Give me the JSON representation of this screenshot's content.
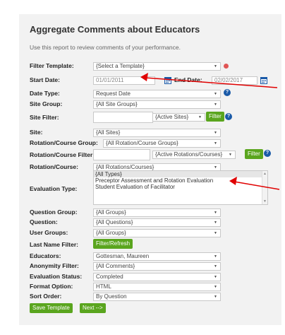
{
  "header": {
    "title": "Aggregate Comments about Educators",
    "subtitle": "Use this report to review comments of your performance."
  },
  "form": {
    "filter_template": {
      "label": "Filter Template:",
      "value": "{Select a Template}"
    },
    "start_date": {
      "label": "Start Date:",
      "value": "01/01/2011"
    },
    "end_date": {
      "label": "End Date:",
      "value": "02/02/2017"
    },
    "date_type": {
      "label": "Date Type:",
      "value": "Request Date"
    },
    "site_group": {
      "label": "Site Group:",
      "value": "{All Site Groups}"
    },
    "site_filter": {
      "label": "Site Filter:",
      "value": "",
      "select_value": "{Active Sites}",
      "button": "Filter"
    },
    "site": {
      "label": "Site:",
      "value": "{All Sites}"
    },
    "rotation_course_group": {
      "label": "Rotation/Course Group:",
      "value": "{All Rotation/Course Groups}"
    },
    "rotation_course_filter": {
      "label": "Rotation/Course Filter:",
      "value": "",
      "select_value": "{Active Rotations/Courses}",
      "button": "Filter"
    },
    "rotation_course": {
      "label": "Rotation/Course:",
      "value": "{All Rotations/Courses}"
    },
    "evaluation_type": {
      "label": "Evaluation Type:",
      "options": [
        "{All Types}",
        "Preceptor Assessment and Rotation Evaluation",
        "Student Evaluation of Facilitator"
      ]
    },
    "question_group": {
      "label": "Question Group:",
      "value": "{All Groups}"
    },
    "question": {
      "label": "Question:",
      "value": "{All Questions}"
    },
    "user_groups": {
      "label": "User Groups:",
      "value": "{All Groups}"
    },
    "last_name_filter": {
      "label": "Last Name Filter:",
      "button": "Filter/Refresh"
    },
    "educators": {
      "label": "Educators:",
      "value": "Gottesman, Maureen"
    },
    "anonymity_filter": {
      "label": "Anonymity Filter:",
      "value": "{All Comments}"
    },
    "evaluation_status": {
      "label": "Evaluation Status:",
      "value": "Completed"
    },
    "format_option": {
      "label": "Format Option:",
      "value": "HTML"
    },
    "sort_order": {
      "label": "Sort Order:",
      "value": "By Question"
    }
  },
  "actions": {
    "save_template": "Save Template",
    "next": "Next -->"
  },
  "icons": {
    "help": "?",
    "calendar": "calendar-icon",
    "remove": "red-circle-icon"
  },
  "colors": {
    "green": "#5aa51e",
    "help_blue": "#1a5aa8",
    "arrow_red": "#e00000"
  }
}
